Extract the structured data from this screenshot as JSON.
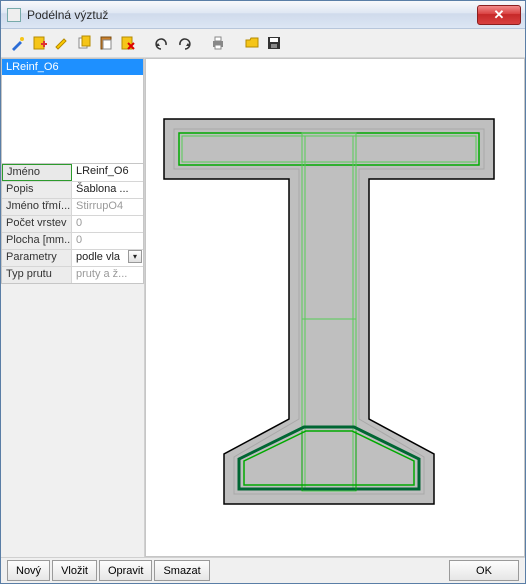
{
  "window": {
    "title": "Podélná výztuž"
  },
  "toolbar_icons": [
    "magic",
    "add",
    "edit",
    "copy",
    "paste",
    "delete",
    "undo",
    "redo",
    "print",
    "open",
    "save"
  ],
  "list": {
    "items": [
      "LReinf_O6"
    ]
  },
  "props": [
    {
      "label": "Jméno",
      "value": "LReinf_O6",
      "dim": false,
      "selected": true
    },
    {
      "label": "Popis",
      "value": "Šablona ...",
      "dim": false
    },
    {
      "label": "Jméno třmí...",
      "value": "StirrupO4",
      "dim": true
    },
    {
      "label": "Počet vrstev",
      "value": "0",
      "dim": true
    },
    {
      "label": "Plocha [mm...",
      "value": "0",
      "dim": true
    },
    {
      "label": "Parametry",
      "value": "podle vla",
      "dim": false,
      "dropdown": true
    },
    {
      "label": "Typ prutu",
      "value": "pruty a ž...",
      "dim": true
    }
  ],
  "footer": {
    "novy": "Nový",
    "vlozit": "Vložit",
    "opravit": "Opravit",
    "smazat": "Smazat",
    "ok": "OK"
  }
}
